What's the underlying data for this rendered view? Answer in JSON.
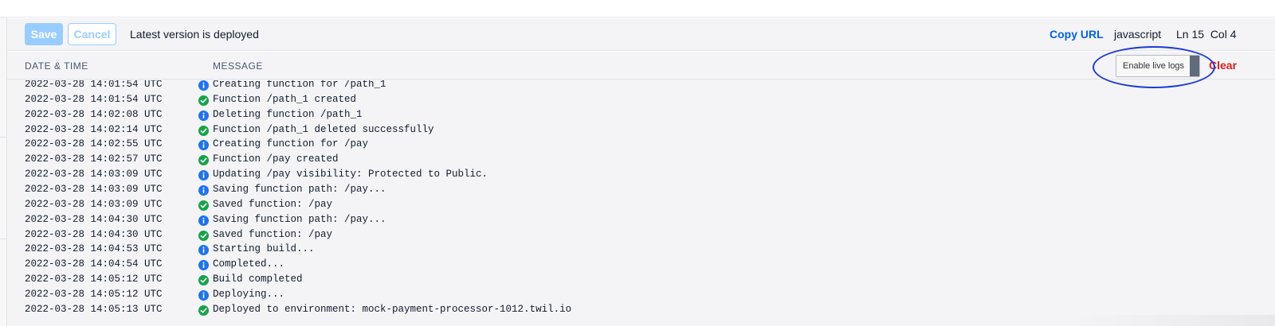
{
  "toolbar": {
    "save_label": "Save",
    "cancel_label": "Cancel",
    "status_text": "Latest version is deployed",
    "copy_url_label": "Copy URL",
    "language": "javascript",
    "cursor_position": "Ln 15  Col 4"
  },
  "console": {
    "header": {
      "date_time": "DATE & TIME",
      "message": "MESSAGE"
    },
    "enable_live_logs_label": "Enable live logs",
    "clear_label": "Clear",
    "colors": {
      "info": "#1e74e8",
      "success": "#16a34a",
      "annotation": "#1b3ad6"
    },
    "logs": [
      {
        "timestamp": "2022-03-28 14:01:54 UTC",
        "level": "info",
        "icon": "info-icon",
        "message": "Creating function for /path_1"
      },
      {
        "timestamp": "2022-03-28 14:01:54 UTC",
        "level": "success",
        "icon": "check-circle-icon",
        "message": "Function /path_1 created"
      },
      {
        "timestamp": "2022-03-28 14:02:08 UTC",
        "level": "info",
        "icon": "info-icon",
        "message": "Deleting function /path_1"
      },
      {
        "timestamp": "2022-03-28 14:02:14 UTC",
        "level": "success",
        "icon": "check-circle-icon",
        "message": "Function /path_1 deleted successfully"
      },
      {
        "timestamp": "2022-03-28 14:02:55 UTC",
        "level": "info",
        "icon": "info-icon",
        "message": "Creating function for /pay"
      },
      {
        "timestamp": "2022-03-28 14:02:57 UTC",
        "level": "success",
        "icon": "check-circle-icon",
        "message": "Function /pay created"
      },
      {
        "timestamp": "2022-03-28 14:03:09 UTC",
        "level": "info",
        "icon": "info-icon",
        "message": "Updating /pay visibility: Protected to Public."
      },
      {
        "timestamp": "2022-03-28 14:03:09 UTC",
        "level": "info",
        "icon": "info-icon",
        "message": "Saving function path: /pay..."
      },
      {
        "timestamp": "2022-03-28 14:03:09 UTC",
        "level": "success",
        "icon": "check-circle-icon",
        "message": "Saved function: /pay"
      },
      {
        "timestamp": "2022-03-28 14:04:30 UTC",
        "level": "info",
        "icon": "info-icon",
        "message": "Saving function path: /pay..."
      },
      {
        "timestamp": "2022-03-28 14:04:30 UTC",
        "level": "success",
        "icon": "check-circle-icon",
        "message": "Saved function: /pay"
      },
      {
        "timestamp": "2022-03-28 14:04:53 UTC",
        "level": "info",
        "icon": "info-icon",
        "message": "Starting build..."
      },
      {
        "timestamp": "2022-03-28 14:04:54 UTC",
        "level": "info",
        "icon": "info-icon",
        "message": "Completed..."
      },
      {
        "timestamp": "2022-03-28 14:05:12 UTC",
        "level": "success",
        "icon": "check-circle-icon",
        "message": "Build completed"
      },
      {
        "timestamp": "2022-03-28 14:05:12 UTC",
        "level": "info",
        "icon": "info-icon",
        "message": "Deploying..."
      },
      {
        "timestamp": "2022-03-28 14:05:13 UTC",
        "level": "success",
        "icon": "check-circle-icon",
        "message": "Deployed to environment: mock-payment-processor-1012.twil.io"
      }
    ]
  }
}
